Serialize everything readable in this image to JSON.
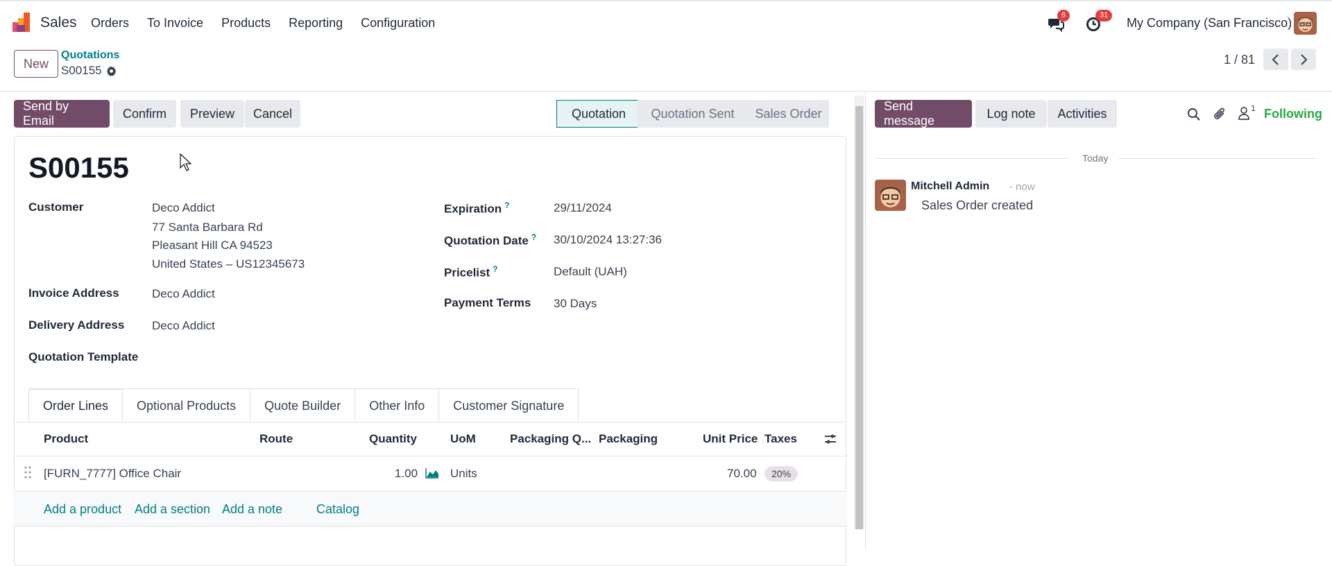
{
  "navbar": {
    "app_name": "Sales",
    "menu": [
      "Orders",
      "To Invoice",
      "Products",
      "Reporting",
      "Configuration"
    ],
    "messages_count": "6",
    "activities_count": "31",
    "company": "My Company (San Francisco)"
  },
  "control": {
    "new_label": "New",
    "breadcrumb": "Quotations",
    "record_ref": "S00155",
    "pager": "1 / 81"
  },
  "actions": {
    "send_email": "Send by Email",
    "confirm": "Confirm",
    "preview": "Preview",
    "cancel": "Cancel"
  },
  "status": [
    "Quotation",
    "Quotation Sent",
    "Sales Order"
  ],
  "form": {
    "title": "S00155",
    "customer_label": "Customer",
    "customer_lines": [
      "Deco Addict",
      "77 Santa Barbara Rd",
      "Pleasant Hill CA 94523",
      "United States – US12345673"
    ],
    "invoice_address_label": "Invoice Address",
    "invoice_address": "Deco Addict",
    "delivery_address_label": "Delivery Address",
    "delivery_address": "Deco Addict",
    "quotation_template_label": "Quotation Template",
    "expiration_label": "Expiration",
    "expiration": "29/11/2024",
    "quotation_date_label": "Quotation Date",
    "quotation_date": "30/10/2024 13:27:36",
    "pricelist_label": "Pricelist",
    "pricelist": "Default (UAH)",
    "payment_terms_label": "Payment Terms",
    "payment_terms": "30 Days",
    "help_mark": "?"
  },
  "tabs": [
    "Order Lines",
    "Optional Products",
    "Quote Builder",
    "Other Info",
    "Customer Signature"
  ],
  "table": {
    "headers": [
      "Product",
      "Route",
      "Quantity",
      "UoM",
      "Packaging Q...",
      "Packaging",
      "Unit Price",
      "Taxes"
    ],
    "rows": [
      {
        "product": "[FURN_7777] Office Chair",
        "quantity": "1.00",
        "uom": "Units",
        "unit_price": "70.00",
        "taxes": "20%"
      }
    ],
    "add_links": [
      "Add a product",
      "Add a section",
      "Add a note",
      "Catalog"
    ]
  },
  "chatter": {
    "send_message": "Send message",
    "log_note": "Log note",
    "activities": "Activities",
    "followers_count": "1",
    "following": "Following",
    "today": "Today",
    "message": {
      "author": "Mitchell Admin",
      "time": "- now",
      "body": "Sales Order created"
    }
  },
  "colors": {
    "primary": "#714b67",
    "accent": "#017e84",
    "badge": "#e23e3e",
    "following": "#28a745"
  }
}
